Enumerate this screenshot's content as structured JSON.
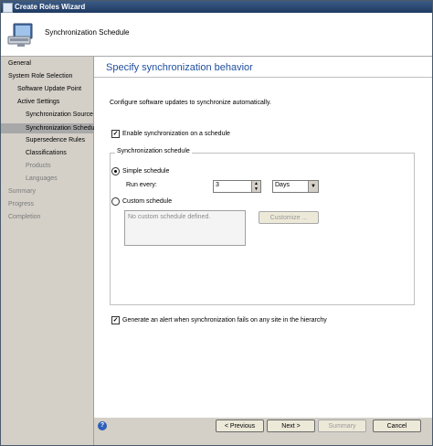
{
  "window": {
    "title": "Create Roles Wizard"
  },
  "banner": {
    "title": "Synchronization Schedule"
  },
  "nav": {
    "items": [
      {
        "label": "General",
        "state": "normal"
      },
      {
        "label": "System Role Selection",
        "state": "normal"
      },
      {
        "label": "Software Update Point",
        "state": "normal"
      },
      {
        "label": "Active Settings",
        "state": "normal"
      },
      {
        "label": "Synchronization Source",
        "state": "normal"
      },
      {
        "label": "Synchronization Schedule",
        "state": "selected"
      },
      {
        "label": "Supersedence Rules",
        "state": "normal"
      },
      {
        "label": "Classifications",
        "state": "normal"
      },
      {
        "label": "Products",
        "state": "disabled"
      },
      {
        "label": "Languages",
        "state": "disabled"
      },
      {
        "label": "Summary",
        "state": "disabled"
      },
      {
        "label": "Progress",
        "state": "disabled"
      },
      {
        "label": "Completion",
        "state": "disabled"
      }
    ]
  },
  "main": {
    "heading": "Specify synchronization behavior",
    "description": "Configure software updates to synchronize automatically.",
    "enable_schedule": {
      "label": "Enable synchronization on a schedule",
      "checked": true
    },
    "group": {
      "title": "Synchronization schedule",
      "simple": {
        "label": "Simple schedule",
        "selected": true
      },
      "run_every_label": "Run every:",
      "run_every_value": "3",
      "unit": "Days",
      "custom": {
        "label": "Custom schedule",
        "selected": false
      },
      "custom_text": "No custom schedule defined.",
      "customize_label": "Customize ..."
    },
    "alert": {
      "label": "Generate an alert when synchronization fails on any site in the hierarchy",
      "checked": true
    }
  },
  "footer": {
    "previous": "< Previous",
    "next": "Next >",
    "summary": "Summary",
    "cancel": "Cancel"
  },
  "icons": {
    "check": "✓",
    "spin_up": "▲",
    "spin_down": "▼",
    "dropdown": "▼",
    "help": "?"
  }
}
